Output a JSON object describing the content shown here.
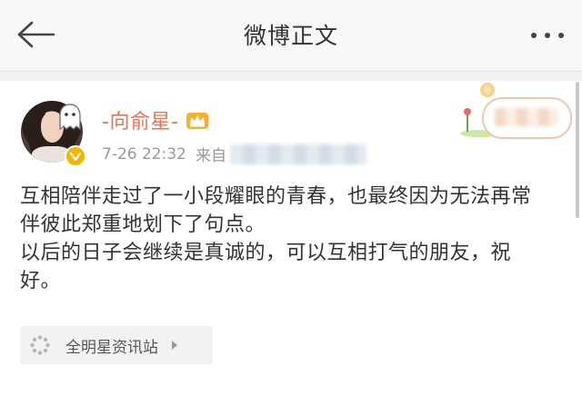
{
  "header": {
    "title": "微博正文",
    "back_icon": "back-arrow-icon",
    "more_icon": "more-dots-icon"
  },
  "post": {
    "username": "-向俞星-",
    "timestamp": "7-26 22:32",
    "source_prefix": "来自",
    "paragraphs": [
      "互相陪伴走过了一小段耀眼的青春，也最终因为无法再常伴彼此郑重地划下了句点。",
      "以后的日子会继续是真诚的，可以互相打气的朋友，祝好。"
    ],
    "topic_tag": "全明星资讯站"
  },
  "colors": {
    "username": "#eb7350",
    "header_bg": "#f8f8f8",
    "verified": "#f7b500"
  }
}
